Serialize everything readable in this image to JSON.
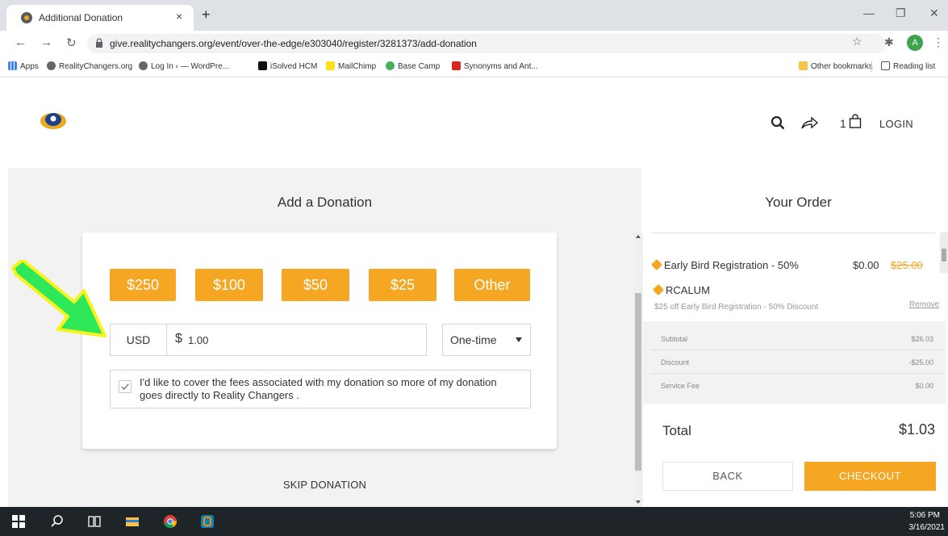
{
  "browser": {
    "tab_title": "Additional Donation",
    "tab_close": "×",
    "new_tab": "+",
    "url": "give.realitychangers.org/event/over-the-edge/e303040/register/3281373/add-donation",
    "profile_initial": "A",
    "bookmarks": [
      "Apps",
      "RealityChangers.org",
      "Log In ‹ — WordPre...",
      "iSolved HCM",
      "MailChimp",
      "Base Camp",
      "Synonyms and Ant..."
    ],
    "other_bookmarks": "Other bookmarks",
    "reading_list": "Reading list"
  },
  "header": {
    "cart_count": "1",
    "login": "LOGIN"
  },
  "donation": {
    "title": "Add a Donation",
    "amounts": [
      "$250",
      "$100",
      "$50",
      "$25",
      "Other"
    ],
    "currency": "USD",
    "dollar_sign": "$",
    "amount_value": "1.00",
    "frequency": "One-time",
    "fee_checked": true,
    "fee_text": "I'd like to cover the fees associated with my donation so more of my donation goes directly to Reality Changers .",
    "skip": "SKIP DONATION"
  },
  "order": {
    "title": "Your Order",
    "item_name": "Early Bird Registration - 50%",
    "item_price": "$0.00",
    "item_old_price": "$25.00",
    "promo_code": "RCALUM",
    "promo_desc": "$25 off Early Bird Registration - 50% Discount",
    "promo_remove": "Remove",
    "summary": [
      {
        "label": "Subtotal",
        "value": "$26.03"
      },
      {
        "label": "Discount",
        "value": "-$25.00"
      },
      {
        "label": "Service Fee",
        "value": "$0.00"
      }
    ],
    "total_label": "Total",
    "total_value": "$1.03",
    "back": "BACK",
    "checkout": "CHECKOUT"
  },
  "colors": {
    "accent": "#f5a623",
    "annotation_arrow": "#2ee85a",
    "annotation_outline": "#f7f21a"
  },
  "taskbar": {
    "time": "5:06 PM",
    "date": "3/16/2021"
  }
}
